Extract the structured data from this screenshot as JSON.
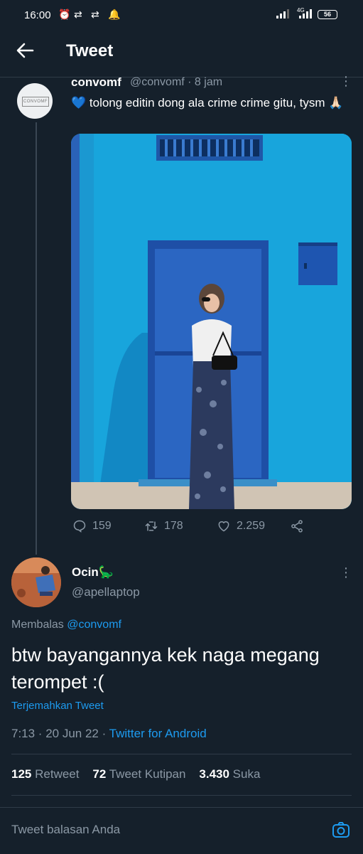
{
  "statusbar": {
    "time": "16:00",
    "battery": "56",
    "network": "4G"
  },
  "header": {
    "title": "Tweet"
  },
  "quoted_tweet": {
    "name": "convomf",
    "handle_time": "@convomf · 8 jam",
    "avatar_text": "CONVOMF",
    "text": "💙 tolong editin dong ala crime crime gitu, tysm 🙏🏻",
    "replies": "159",
    "retweets": "178",
    "likes": "2.259"
  },
  "reply": {
    "name": "Ocin🦕",
    "handle": "@apellaptop",
    "replying_prefix": "Membalas ",
    "replying_to": "@convomf",
    "text": "btw bayangannya kek naga megang terompet :(",
    "translate": "Terjemahkan Tweet",
    "time_date": "7:13 · 20 Jun 22 · ",
    "source": "Twitter for Android",
    "retweet_count": "125",
    "retweet_label": "Retweet",
    "quote_count": "72",
    "quote_label": "Tweet Kutipan",
    "like_count": "3.430",
    "like_label": "Suka"
  },
  "composer": {
    "placeholder": "Tweet balasan Anda"
  },
  "colors": {
    "background": "#15202b",
    "accent": "#1d9bf0",
    "muted": "#8b98a5"
  }
}
